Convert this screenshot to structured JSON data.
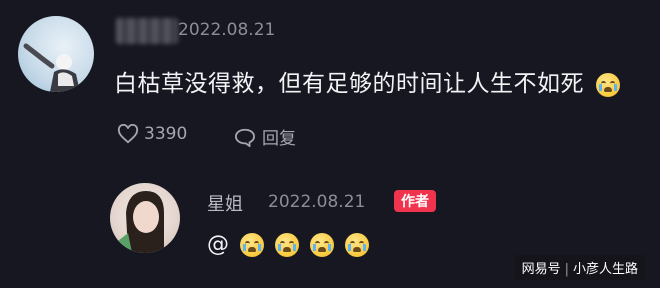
{
  "comment": {
    "date": "2022.08.21",
    "text": "白枯草没得救，但有足够的时间让人生不如死",
    "likes": "3390",
    "reply_label": "回复"
  },
  "reply": {
    "name": "星姐",
    "date": "2022.08.21",
    "badge": "作者",
    "at_symbol": "@"
  },
  "watermark": {
    "site": "网易号",
    "separator": "|",
    "author": "小彦人生路"
  },
  "icons": [
    "crying-emoji-icon",
    "heart-icon",
    "comment-bubble-icon"
  ],
  "colors": {
    "background": "#161721",
    "badge": "#f0344e",
    "meta_text": "#8c8d95"
  }
}
